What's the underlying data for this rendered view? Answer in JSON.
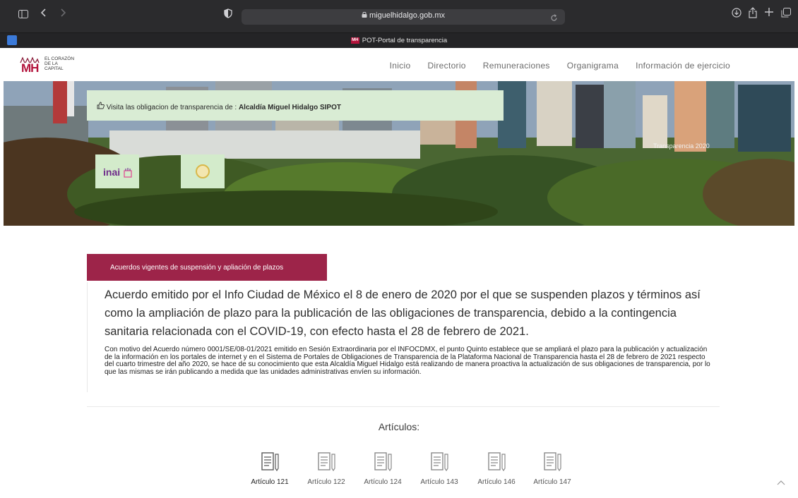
{
  "browser": {
    "url": "miguelhidalgo.gob.mx",
    "tab_title": "POT-Portal de transparencia",
    "tab_favicon_text": "MH"
  },
  "site": {
    "logo": {
      "mark": "MH",
      "line1": "EL CORAZÓN",
      "line2": "DE LA",
      "line3": "CAPITAL"
    },
    "nav": [
      "Inicio",
      "Directorio",
      "Remuneraciones",
      "Organigrama",
      "Información de ejercicio"
    ]
  },
  "hero": {
    "notice_prefix": "Visita las obligacion de transparencia de : ",
    "notice_bold": "Alcaldía Miguel Hidalgo SIPOT",
    "caption": "Transparencia   2020",
    "badge_inai": "inai"
  },
  "content": {
    "pill_label": "Acuerdos vigentes de suspensión y apliación de plazos",
    "headline": "Acuerdo emitido por el Info Ciudad de México el 8 de enero de 2020 por el que se suspenden plazos y términos así como la ampliación de plazo para la publicación de las obligaciones de transparencia, debido a la contingencia sanitaria relacionada con el COVID-19, con efecto hasta el 28 de febrero de 2021.",
    "paragraph": "Con motivo del Acuerdo número 0001/SE/08-01/2021 emitido en Sesión Extraordinaria por el INFOCDMX, el punto Quinto establece que se ampliará el plazo para la publicación y actualización de la información en los portales de internet y en el Sistema de Portales de Obligaciones de Transparencia de la Plataforma Nacional de Transparencia hasta el 28 de febrero de 2021 respecto del cuarto trimestre del año 2020, se hace de su conocimiento que esta Alcaldía Miguel Hidalgo está realizando de manera proactiva la actualización de sus obligaciones de transparencia, por lo que las mismas se irán publicando a medida que las unidades administrativas envíen su información.",
    "articulos_title": "Artículos:",
    "articulos": [
      "Artículo 121",
      "Artículo 122",
      "Artículo 124",
      "Artículo 143",
      "Artículo 146",
      "Artículo 147"
    ]
  },
  "colors": {
    "brand": "#9d2449",
    "notice_bg": "#d9ecd4",
    "chrome": "#2b2b2d"
  }
}
